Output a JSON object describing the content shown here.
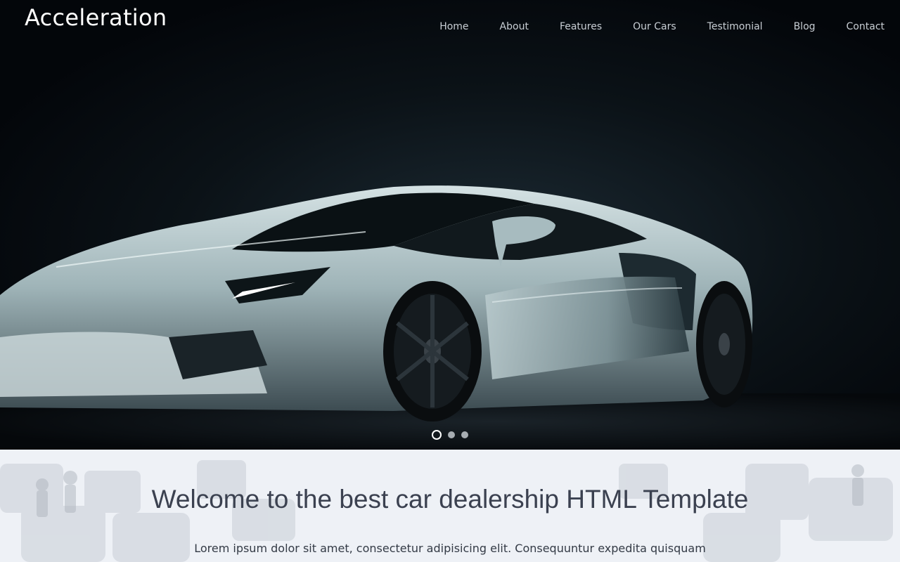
{
  "header": {
    "brand": "Acceleration",
    "nav": [
      {
        "label": "Home"
      },
      {
        "label": "About"
      },
      {
        "label": "Features"
      },
      {
        "label": "Our Cars"
      },
      {
        "label": "Testimonial"
      },
      {
        "label": "Blog"
      },
      {
        "label": "Contact"
      }
    ]
  },
  "hero": {
    "image": "sports-car-photo",
    "slides": 3,
    "active_slide": 1
  },
  "welcome": {
    "title": "Welcome to the best car dealership HTML Template",
    "text": "Lorem ipsum dolor sit amet, consectetur adipisicing elit. Consequuntur expedita quisquam"
  },
  "colors": {
    "hero_bg": "#03060a",
    "nav_text": "#c8ced4",
    "section_bg": "#eef1f6",
    "title_text": "#3b4150"
  }
}
